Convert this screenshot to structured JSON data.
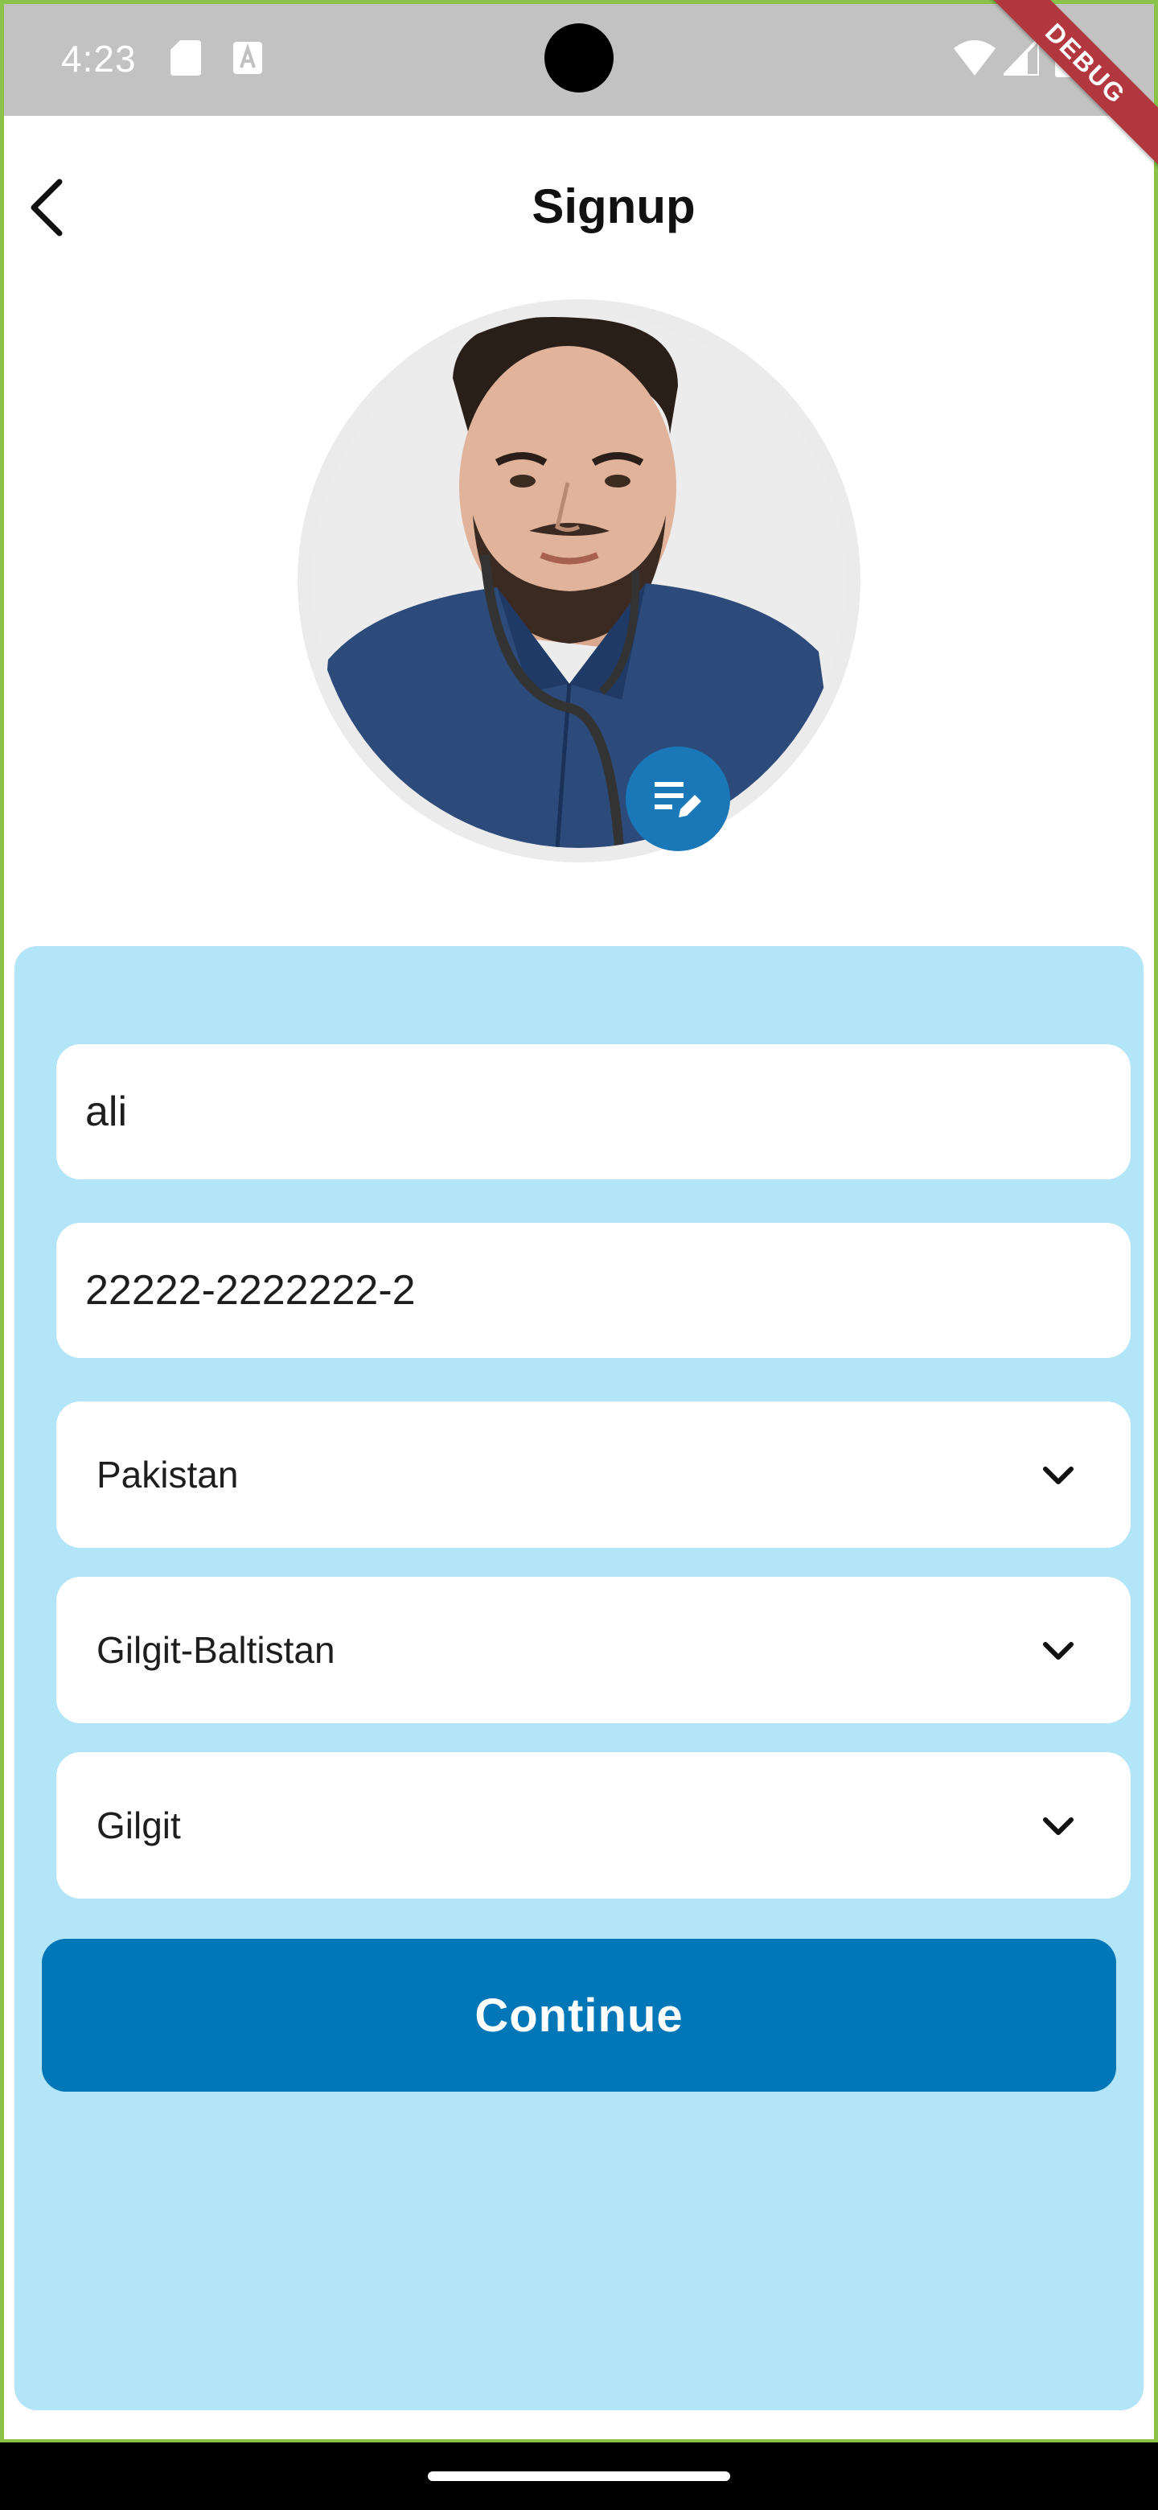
{
  "status_bar": {
    "time": "4:23",
    "icons": [
      "sd-card-icon",
      "a-notification-icon",
      "wifi-icon",
      "cell-signal-icon",
      "battery-icon"
    ]
  },
  "debug_banner": "DEBUG",
  "app_bar": {
    "title": "Signup",
    "back_icon": "arrow-back-icon"
  },
  "profile": {
    "edit_icon": "edit-note-icon"
  },
  "form": {
    "name_value": "ali",
    "cnic_value": "22222-2222222-2",
    "country_value": "Pakistan",
    "province_value": "Gilgit-Baltistan",
    "city_value": "Gilgit",
    "continue_label": "Continue"
  },
  "colors": {
    "primary": "#0277b7",
    "card_background": "#b3e5f8",
    "status_bar": "#c2c2c2",
    "debug_ribbon": "#b2373f"
  }
}
